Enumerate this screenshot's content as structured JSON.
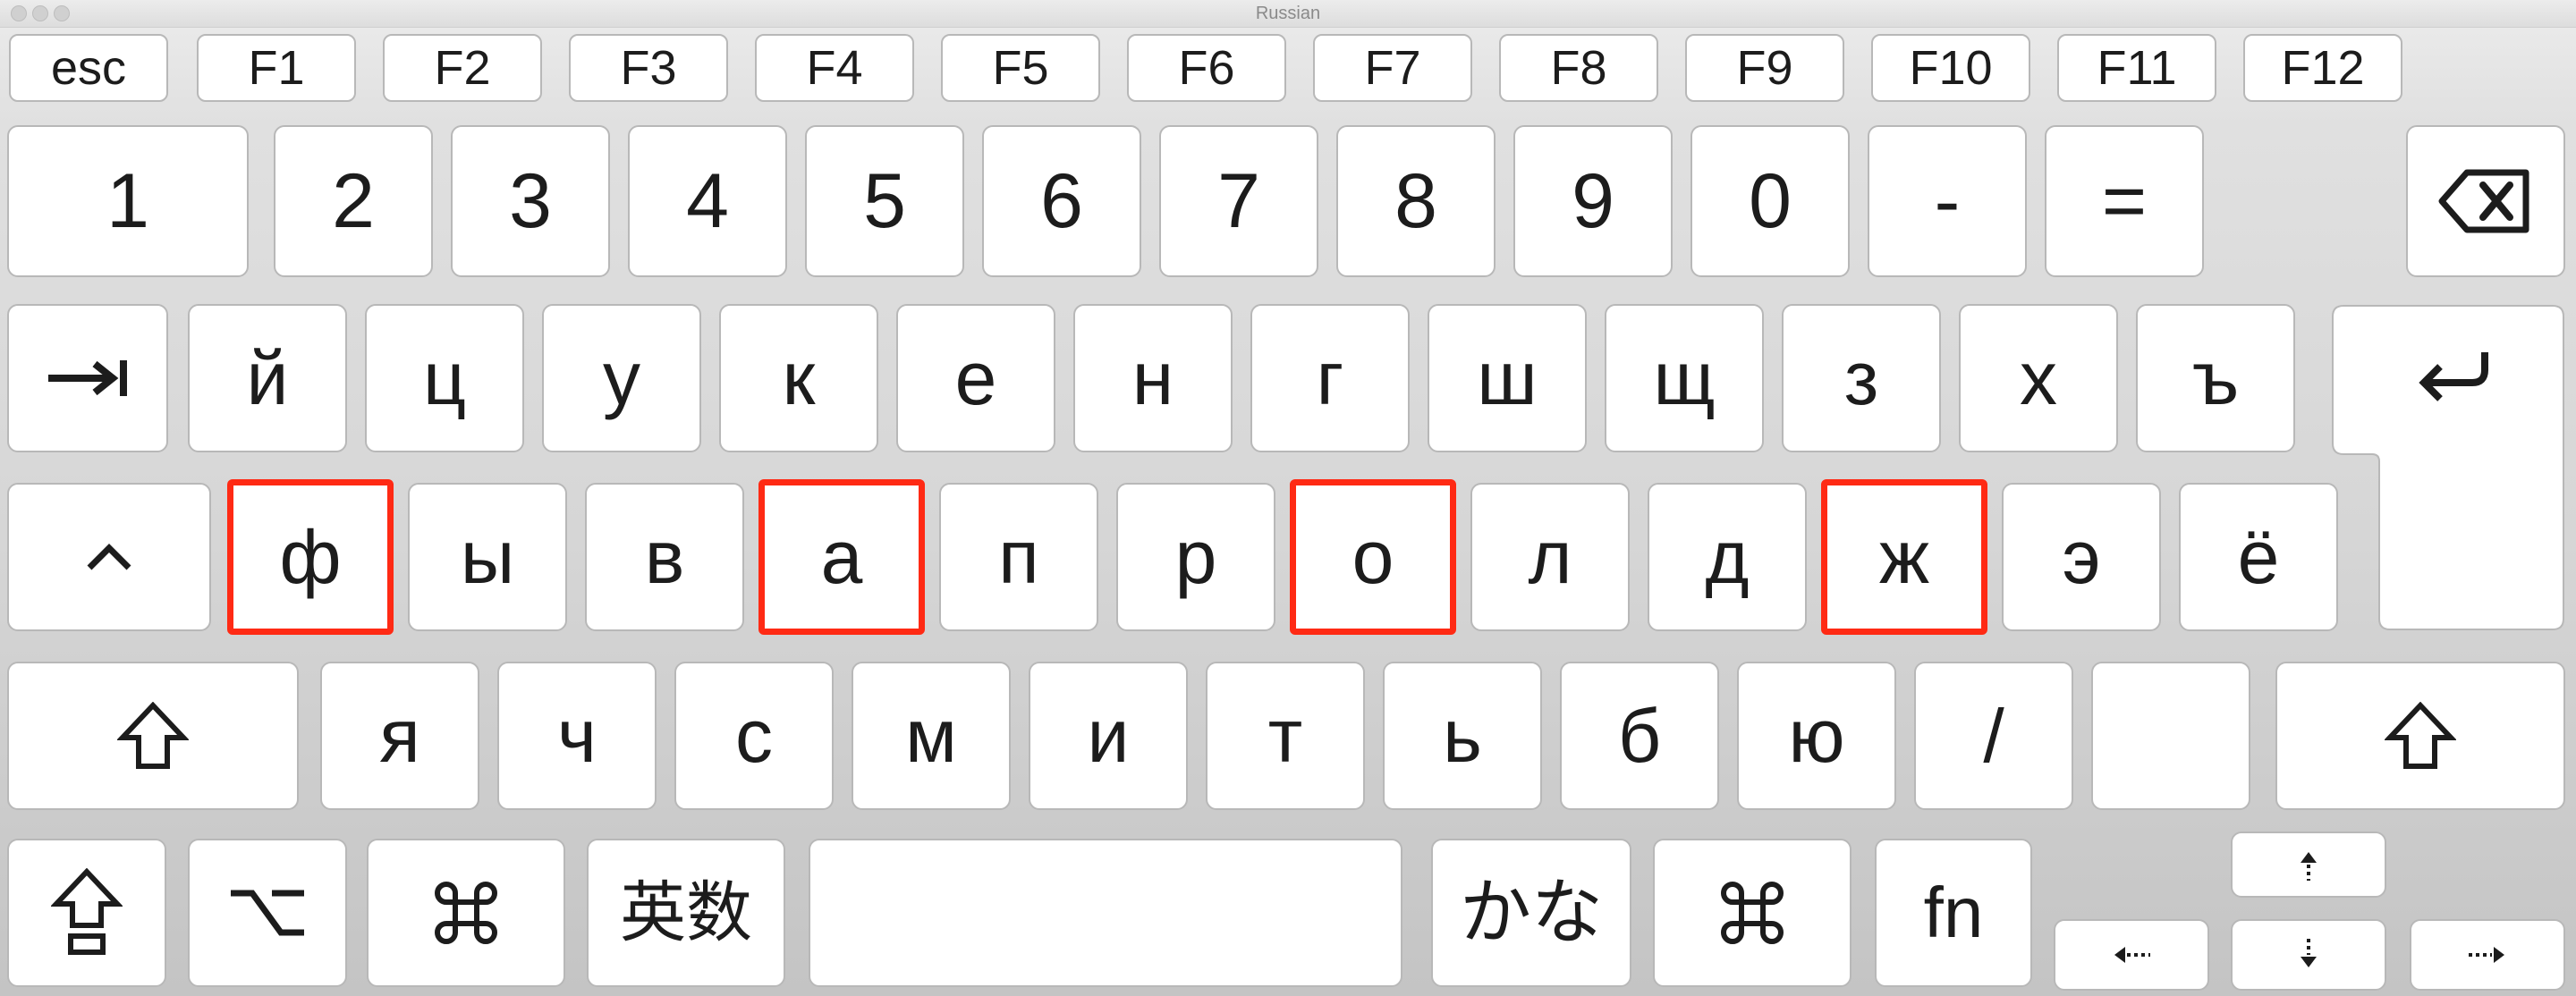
{
  "window": {
    "title": "Russian"
  },
  "keyboard": {
    "layout": "Russian",
    "highlight_color": "#ff2a14",
    "function_row": [
      "esc",
      "F1",
      "F2",
      "F3",
      "F4",
      "F5",
      "F6",
      "F7",
      "F8",
      "F9",
      "F10",
      "F11",
      "F12"
    ],
    "number_row": [
      "1",
      "2",
      "3",
      "4",
      "5",
      "6",
      "7",
      "8",
      "9",
      "0",
      "-",
      "="
    ],
    "top_row": [
      "й",
      "ц",
      "у",
      "к",
      "е",
      "н",
      "г",
      "ш",
      "щ",
      "з",
      "х",
      "ъ"
    ],
    "home_row": [
      "ф",
      "ы",
      "в",
      "а",
      "п",
      "р",
      "о",
      "л",
      "д",
      "ж",
      "э",
      "ё"
    ],
    "bottom_row": [
      "я",
      "ч",
      "с",
      "м",
      "и",
      "т",
      "ь",
      "б",
      "ю",
      "/"
    ],
    "space_row": {
      "eisu": "英数",
      "kana": "かな",
      "fn": "fn"
    },
    "highlighted_keys": [
      "ф",
      "а",
      "о",
      "ж"
    ],
    "icons": {
      "delete": "delete-icon",
      "tab": "tab-icon",
      "return": "return-icon",
      "control": "control-icon",
      "shift": "shift-icon",
      "caps_lock": "caps-lock-icon",
      "option": "option-icon",
      "command": "command-icon",
      "arrows": [
        "arrow-up-icon",
        "arrow-left-icon",
        "arrow-down-icon",
        "arrow-right-icon"
      ]
    }
  }
}
